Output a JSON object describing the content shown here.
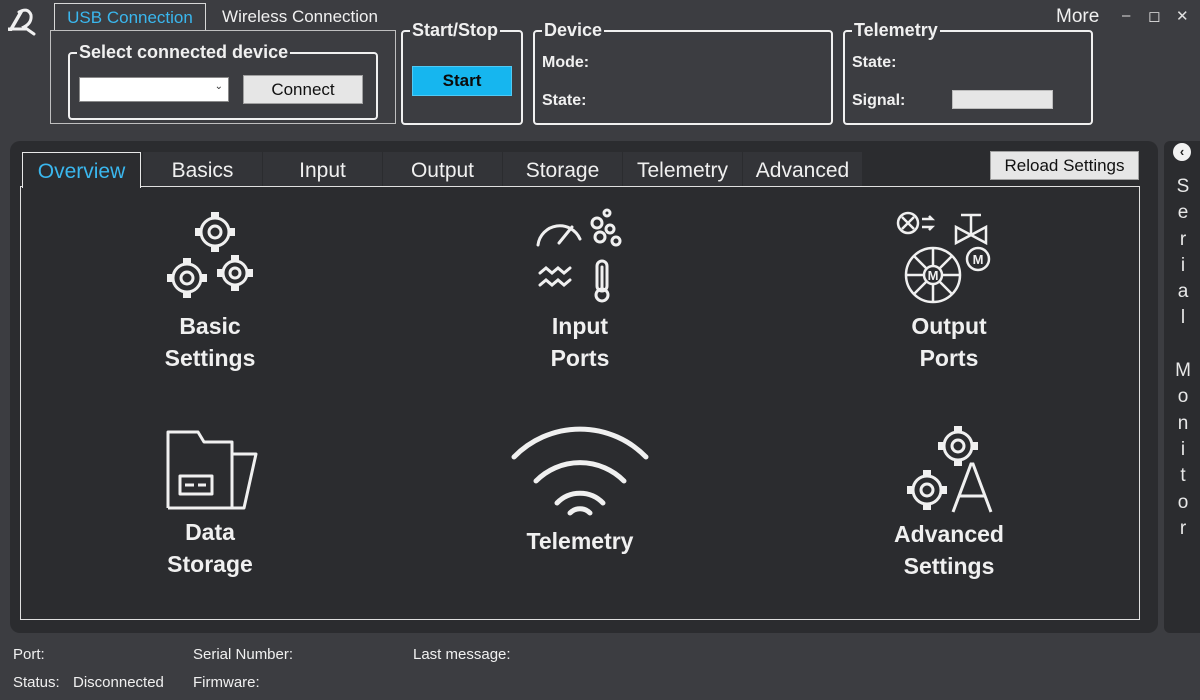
{
  "connection_tabs": {
    "usb": "USB Connection",
    "wireless": "Wireless Connection"
  },
  "select_device": {
    "title": "Select connected device",
    "connect_label": "Connect"
  },
  "start_stop": {
    "title": "Start/Stop",
    "start_label": "Start"
  },
  "device": {
    "title": "Device",
    "mode_label": "Mode:",
    "state_label": "State:"
  },
  "telemetry_group": {
    "title": "Telemetry",
    "state_label": "State:",
    "signal_label": "Signal:",
    "signal_level": 0
  },
  "window": {
    "more": "More",
    "minimize": "–",
    "maximize": "◻",
    "close": "✕"
  },
  "tabs": [
    {
      "label": "Overview"
    },
    {
      "label": "Basics"
    },
    {
      "label": "Input"
    },
    {
      "label": "Output"
    },
    {
      "label": "Storage"
    },
    {
      "label": "Telemetry"
    },
    {
      "label": "Advanced"
    }
  ],
  "reload_label": "Reload Settings",
  "tiles": [
    {
      "line1": "Basic",
      "line2": "Settings",
      "icon": "gears-icon"
    },
    {
      "line1": "Input",
      "line2": "Ports",
      "icon": "sensors-icon"
    },
    {
      "line1": "Output",
      "line2": "Ports",
      "icon": "actuators-icon"
    },
    {
      "line1": "Data",
      "line2": "Storage",
      "icon": "folder-icon"
    },
    {
      "line1": "Telemetry",
      "line2": "",
      "icon": "wifi-icon"
    },
    {
      "line1": "Advanced",
      "line2": "Settings",
      "icon": "gears-a-icon"
    }
  ],
  "serial_monitor": {
    "label": "Serial Monitor",
    "vertical": "S\ne\nr\ni\na\nl\n\nM\no\nn\ni\nt\no\nr",
    "arrow": "‹"
  },
  "status": {
    "port_label": "Port:",
    "status_label": "Status:",
    "status_value": "Disconnected",
    "serial_label": "Serial Number:",
    "firmware_label": "Firmware:",
    "last_message_label": "Last message:"
  },
  "colors": {
    "accent": "#3ab7ee",
    "start_button": "#16b6ef",
    "background": "#3c3d41",
    "panel": "#2b2c2f"
  }
}
